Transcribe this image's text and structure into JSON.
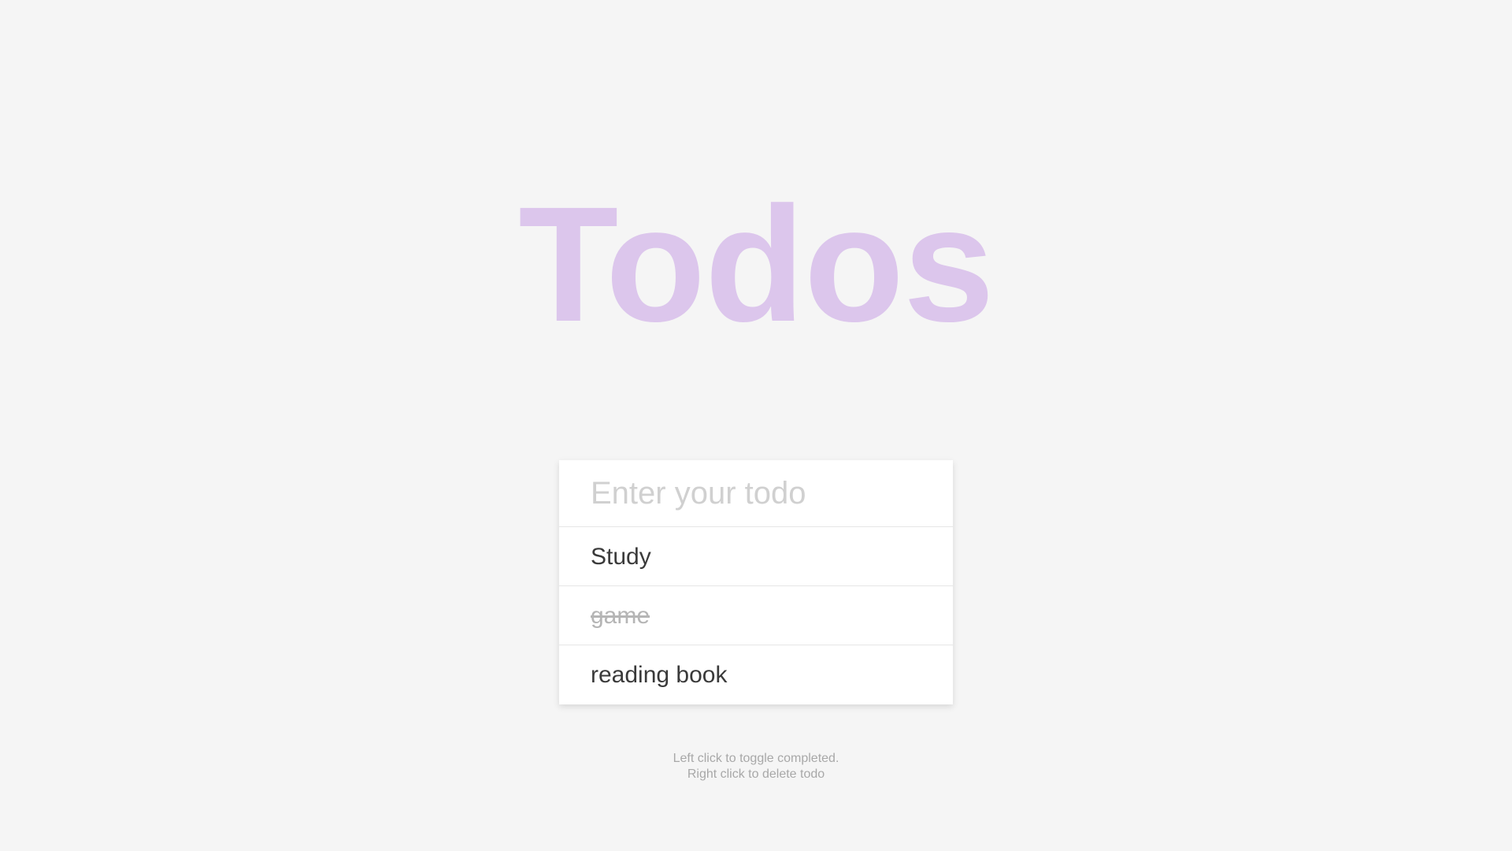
{
  "title": "Todos",
  "input": {
    "placeholder": "Enter your todo",
    "value": ""
  },
  "todos": [
    {
      "text": "Study",
      "completed": false
    },
    {
      "text": "game",
      "completed": true
    },
    {
      "text": "reading book",
      "completed": false
    }
  ],
  "hint": {
    "line1": "Left click to toggle completed.",
    "line2": "Right click to delete todo"
  },
  "colors": {
    "title": "#dcc6ec",
    "background": "#f5f5f5",
    "completed_text": "#b5b5b5"
  }
}
